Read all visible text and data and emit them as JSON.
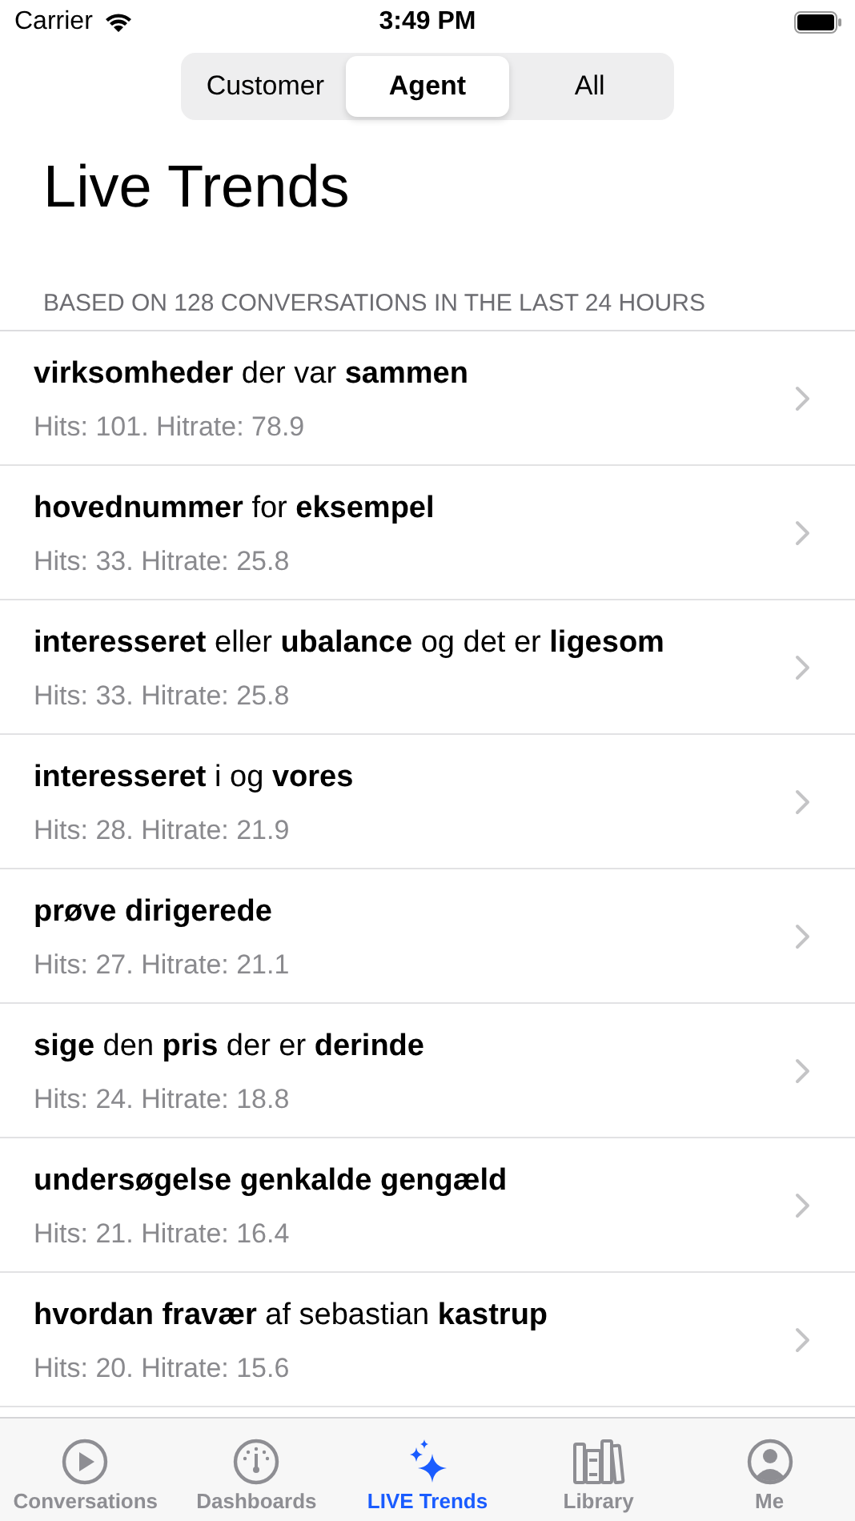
{
  "status_bar": {
    "carrier": "Carrier",
    "time": "3:49 PM"
  },
  "segments": [
    {
      "label": "Customer",
      "selected": false
    },
    {
      "label": "Agent",
      "selected": true
    },
    {
      "label": "All",
      "selected": false
    }
  ],
  "title": "Live Trends",
  "section_header": "BASED ON 128 CONVERSATIONS IN THE LAST 24 HOURS",
  "rows": [
    {
      "title": "**virksomheder** der var **sammen**",
      "detail": "Hits: 101. Hitrate: 78.9"
    },
    {
      "title": "**hovednummer** for **eksempel**",
      "detail": "Hits: 33. Hitrate: 25.8"
    },
    {
      "title": "**interesseret** eller **ubalance** og det er **ligesom**",
      "detail": "Hits: 33. Hitrate: 25.8"
    },
    {
      "title": "**interesseret** i og **vores**",
      "detail": "Hits: 28. Hitrate: 21.9"
    },
    {
      "title": "**prøve dirigerede**",
      "detail": "Hits: 27. Hitrate: 21.1"
    },
    {
      "title": "**sige** den **pris** der er **derinde**",
      "detail": "Hits: 24. Hitrate: 18.8"
    },
    {
      "title": "**undersøgelse genkalde gengæld**",
      "detail": "Hits: 21. Hitrate: 16.4"
    },
    {
      "title": "**hvordan fravær** af sebastian **kastrup**",
      "detail": "Hits: 20. Hitrate: 15.6"
    }
  ],
  "tab_bar": [
    {
      "label": "Conversations",
      "kind": "play",
      "selected": false
    },
    {
      "label": "Dashboards",
      "kind": "gauge",
      "selected": false
    },
    {
      "label": "LIVE Trends",
      "kind": "sparkles",
      "selected": true
    },
    {
      "label": "Library",
      "kind": "books",
      "selected": false
    },
    {
      "label": "Me",
      "kind": "person",
      "selected": false
    }
  ]
}
